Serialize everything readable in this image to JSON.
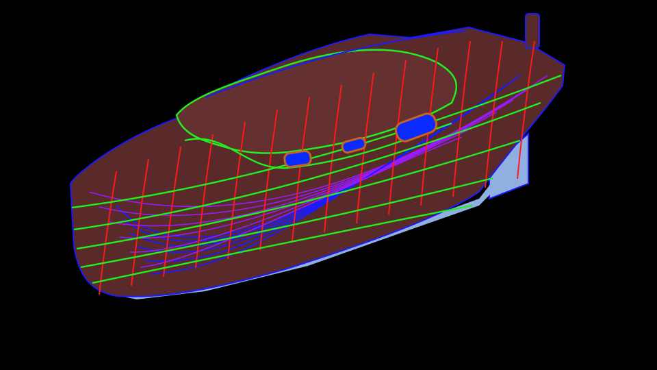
{
  "scene": {
    "subject": "boat-hull-wireframe-render",
    "colors": {
      "background": "#000000",
      "hull": "#5a2a2a",
      "underbody": "#8fb0e0",
      "waterlines": "#22ee22",
      "stations": "#ff1a1a",
      "buttocks": "#1a1aff",
      "diagonals": "#9a1aff",
      "porthole_glass": "#0a2aff",
      "porthole_frame": "#c8641e"
    }
  }
}
